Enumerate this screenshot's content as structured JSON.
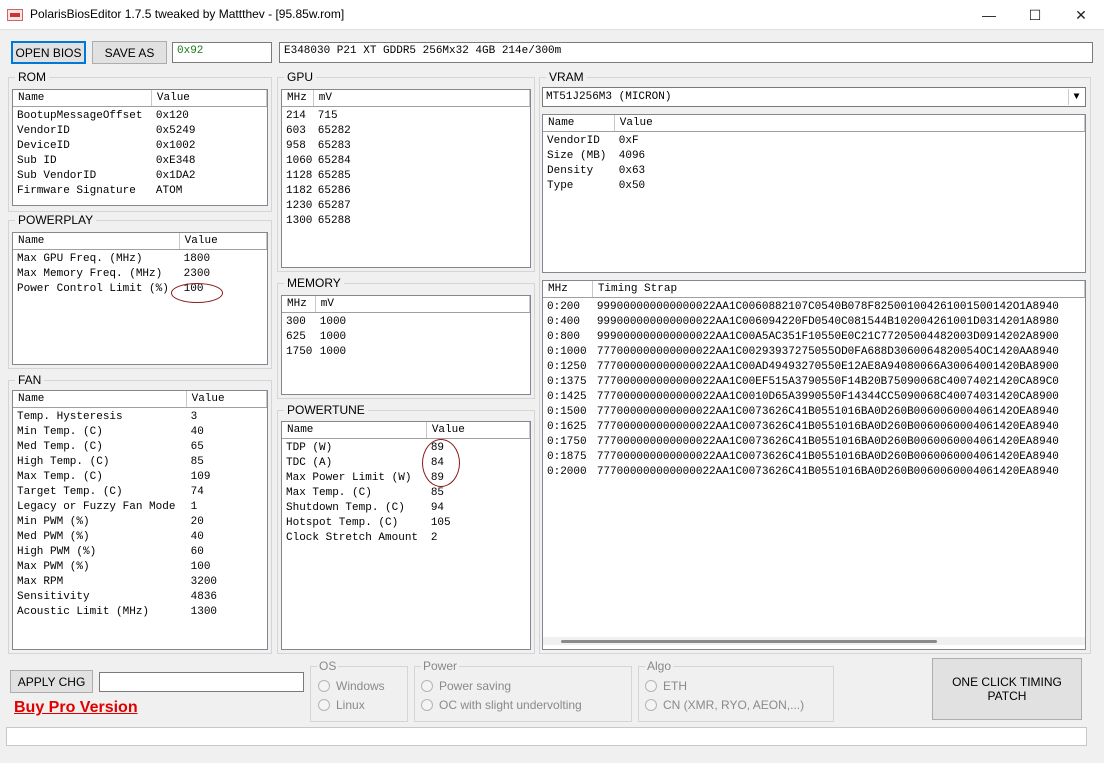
{
  "window": {
    "title": "PolarisBiosEditor 1.7.5 tweaked by Mattthev  - [95.85w.rom]",
    "minimize_glyph": "—",
    "maximize_glyph": "☐",
    "close_glyph": "✕"
  },
  "toolbar": {
    "open_label": "OPEN BIOS",
    "save_label": "SAVE AS",
    "checksum": "0x92",
    "bios_info": "E348030 P21 XT GDDR5 256Mx32 4GB 214e/300m"
  },
  "rom": {
    "title": "ROM",
    "headers": [
      "Name",
      "Value"
    ],
    "rows": [
      [
        "BootupMessageOffset",
        "0x120"
      ],
      [
        "VendorID",
        "0x5249"
      ],
      [
        "DeviceID",
        "0x1002"
      ],
      [
        "Sub ID",
        "0xE348"
      ],
      [
        "Sub VendorID",
        "0x1DA2"
      ],
      [
        "Firmware Signature",
        "ATOM"
      ]
    ]
  },
  "powerplay": {
    "title": "POWERPLAY",
    "headers": [
      "Name",
      "Value"
    ],
    "rows": [
      [
        "Max GPU Freq. (MHz)",
        "1800"
      ],
      [
        "Max Memory Freq. (MHz)",
        "2300"
      ],
      [
        "Power Control Limit (%)",
        "100"
      ]
    ]
  },
  "fan": {
    "title": "FAN",
    "headers": [
      "Name",
      "Value"
    ],
    "rows": [
      [
        "Temp. Hysteresis",
        "3"
      ],
      [
        "Min Temp. (C)",
        "40"
      ],
      [
        "Med Temp. (C)",
        "65"
      ],
      [
        "High Temp. (C)",
        "85"
      ],
      [
        "Max Temp. (C)",
        "109"
      ],
      [
        "Target Temp. (C)",
        "74"
      ],
      [
        "Legacy or Fuzzy Fan Mode",
        "1"
      ],
      [
        "Min PWM (%)",
        "20"
      ],
      [
        "Med PWM (%)",
        "40"
      ],
      [
        "High PWM (%)",
        "60"
      ],
      [
        "Max PWM (%)",
        "100"
      ],
      [
        "Max RPM",
        "3200"
      ],
      [
        "Sensitivity",
        "4836"
      ],
      [
        "Acoustic Limit (MHz)",
        "1300"
      ]
    ]
  },
  "gpu": {
    "title": "GPU",
    "headers": [
      "MHz",
      "mV"
    ],
    "rows": [
      [
        "214",
        "715"
      ],
      [
        "603",
        "65282"
      ],
      [
        "958",
        "65283"
      ],
      [
        "1060",
        "65284"
      ],
      [
        "1128",
        "65285"
      ],
      [
        "1182",
        "65286"
      ],
      [
        "1230",
        "65287"
      ],
      [
        "1300",
        "65288"
      ]
    ]
  },
  "memory": {
    "title": "MEMORY",
    "headers": [
      "MHz",
      "mV"
    ],
    "rows": [
      [
        "300",
        "1000"
      ],
      [
        "625",
        "1000"
      ],
      [
        "1750",
        "1000"
      ]
    ]
  },
  "powertune": {
    "title": "POWERTUNE",
    "headers": [
      "Name",
      "Value"
    ],
    "rows": [
      [
        "TDP (W)",
        "89"
      ],
      [
        "TDC (A)",
        "84"
      ],
      [
        "Max Power Limit (W)",
        "89"
      ],
      [
        "Max Temp. (C)",
        "85"
      ],
      [
        "Shutdown Temp. (C)",
        "94"
      ],
      [
        "Hotspot Temp. (C)",
        "105"
      ],
      [
        "Clock Stretch Amount",
        "2"
      ]
    ]
  },
  "vram": {
    "title": "VRAM",
    "selected": "MT51J256M3 (MICRON)",
    "headers": [
      "Name",
      "Value"
    ],
    "rows": [
      [
        "VendorID",
        "0xF"
      ],
      [
        "Size (MB)",
        "4096"
      ],
      [
        "Density",
        "0x63"
      ],
      [
        "Type",
        "0x50"
      ]
    ]
  },
  "timing": {
    "headers": [
      "MHz",
      "Timing Strap"
    ],
    "rows": [
      [
        "0:200",
        "999000000000000022AA1C0060882107C0540B078F825001004261001500142O1A8940"
      ],
      [
        "0:400",
        "999000000000000022AA1C006094220FD0540C081544B102004261001D0314201A8980"
      ],
      [
        "0:800",
        "999000000000000022AA1C00A5AC351F10550E0C21C77205004482003D0914202A8900"
      ],
      [
        "0:1000",
        "777000000000000022AA1C00293937275055OD0FA688D3060064820054OC1420AA8940"
      ],
      [
        "0:1250",
        "777000000000000022AA1C00AD49493270550E12AE8A94080066A30064001420BA8900"
      ],
      [
        "0:1375",
        "777000000000000022AA1C00EF515A3790550F14B20B75090068C40074021420CA89C0"
      ],
      [
        "0:1425",
        "777000000000000022AA1C0010D65A3990550F14344CC5090068C40074031420CA8900"
      ],
      [
        "0:1500",
        "777000000000000022AA1C0073626C41B0551016BA0D260B006006000406142OEA8940"
      ],
      [
        "0:1625",
        "777000000000000022AA1C0073626C41B0551016BA0D260B0060060004061420EA8940"
      ],
      [
        "0:1750",
        "777000000000000022AA1C0073626C41B0551016BA0D260B0060060004061420EA8940"
      ],
      [
        "0:1875",
        "777000000000000022AA1C0073626C41B0551016BA0D260B0060060004061420EA8940"
      ],
      [
        "0:2000",
        "777000000000000022AA1C0073626C41B0551016BA0D260B0060060004061420EA8940"
      ]
    ]
  },
  "bottom": {
    "apply_label": "APPLY CHG",
    "apply_field": "",
    "buy_pro": "Buy Pro Version",
    "os_title": "OS",
    "os_options": [
      "Windows",
      "Linux"
    ],
    "power_title": "Power",
    "power_options": [
      "Power saving",
      "OC with slight undervolting"
    ],
    "algo_title": "Algo",
    "algo_options": [
      "ETH",
      "CN (XMR, RYO, AEON,...)"
    ],
    "one_click_label": "ONE CLICK TIMING PATCH",
    "status": ""
  },
  "colors": {
    "checksum_text": "#1a7a1a",
    "buy_pro": "#e00000",
    "annotation": "#8b1a1a"
  }
}
